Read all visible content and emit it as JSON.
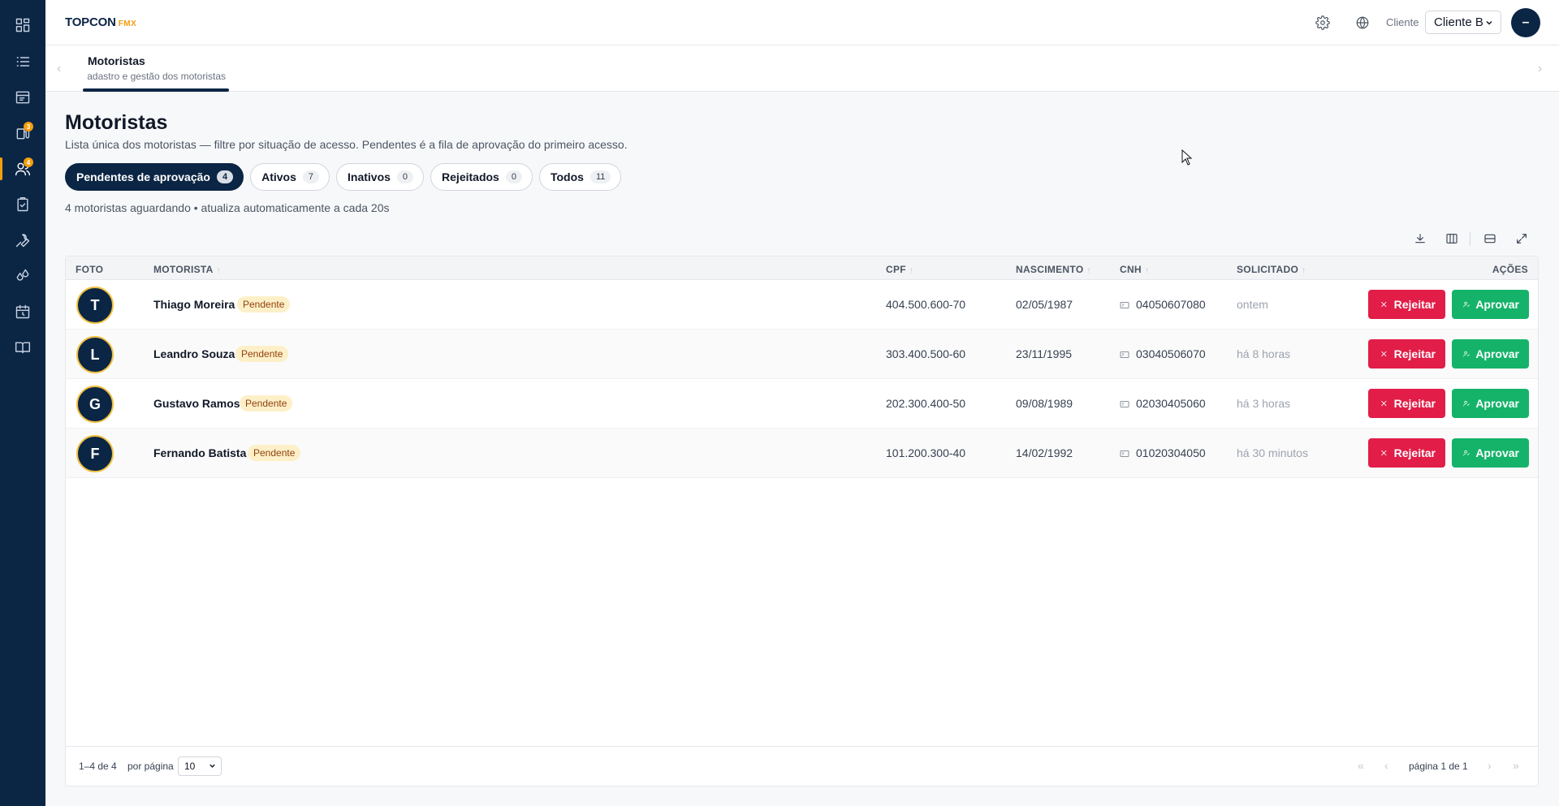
{
  "app": {
    "brand": "TOPCON",
    "brand_suffix": "FMX"
  },
  "sidebar": {
    "items": [
      {
        "icon": "dashboard-icon",
        "badge": ""
      },
      {
        "icon": "list-icon",
        "badge": ""
      },
      {
        "icon": "report-icon",
        "badge": ""
      },
      {
        "icon": "fuel-icon",
        "badge": "3"
      },
      {
        "icon": "users-icon",
        "badge": "4",
        "active": true
      },
      {
        "icon": "clipboard-check-icon",
        "badge": ""
      },
      {
        "icon": "wrench-icon",
        "badge": ""
      },
      {
        "icon": "drops-icon",
        "badge": ""
      },
      {
        "icon": "calendar-clock-icon",
        "badge": ""
      },
      {
        "icon": "book-icon",
        "badge": ""
      }
    ],
    "accent": "#f59e0b"
  },
  "topbar": {
    "client_label": "Cliente",
    "client_value": "Cliente B",
    "user_initial": "–"
  },
  "tabs": {
    "title": "Motoristas",
    "subtitle": "Cadastro e gestão dos motoristas"
  },
  "page": {
    "title": "Motoristas",
    "subtitle": "Lista única dos motoristas — filtre por situação de acesso. Pendentes é a fila de aprovação do primeiro acesso.",
    "info": "4 motoristas aguardando • atualiza automaticamente a cada 20s"
  },
  "filters": [
    {
      "label": "Pendentes de aprovação",
      "count": "4",
      "active": true
    },
    {
      "label": "Ativos",
      "count": "7"
    },
    {
      "label": "Inativos",
      "count": "0"
    },
    {
      "label": "Rejeitados",
      "count": "0"
    },
    {
      "label": "Todos",
      "count": "11"
    }
  ],
  "table": {
    "headers": {
      "foto": "FOTO",
      "motorista": "MOTORISTA",
      "cpf": "CPF",
      "nascimento": "NASCIMENTO",
      "cnh": "CNH",
      "solicitado": "SOLICITADO",
      "acoes": "AÇÕES"
    },
    "rows": [
      {
        "initial": "T",
        "name": "Thiago Moreira",
        "status": "Pendente",
        "cpf": "404.500.600-70",
        "nascimento": "02/05/1987",
        "cnh": "04050607080",
        "solicitado": "ontem"
      },
      {
        "initial": "L",
        "name": "Leandro Souza",
        "status": "Pendente",
        "cpf": "303.400.500-60",
        "nascimento": "23/11/1995",
        "cnh": "03040506070",
        "solicitado": "há 8 horas"
      },
      {
        "initial": "G",
        "name": "Gustavo Ramos",
        "status": "Pendente",
        "cpf": "202.300.400-50",
        "nascimento": "09/08/1989",
        "cnh": "02030405060",
        "solicitado": "há 3 horas"
      },
      {
        "initial": "F",
        "name": "Fernando Batista",
        "status": "Pendente",
        "cpf": "101.200.300-40",
        "nascimento": "14/02/1992",
        "cnh": "01020304050",
        "solicitado": "há 30 minutos"
      }
    ],
    "reject_label": "Rejeitar",
    "approve_label": "Aprovar",
    "reject_color": "#e11d48",
    "approve_color": "#15b36a"
  },
  "footer": {
    "range": "1–4 de 4",
    "per_page_label": "por página",
    "per_page_value": "10",
    "page_label": "página 1 de 1"
  }
}
